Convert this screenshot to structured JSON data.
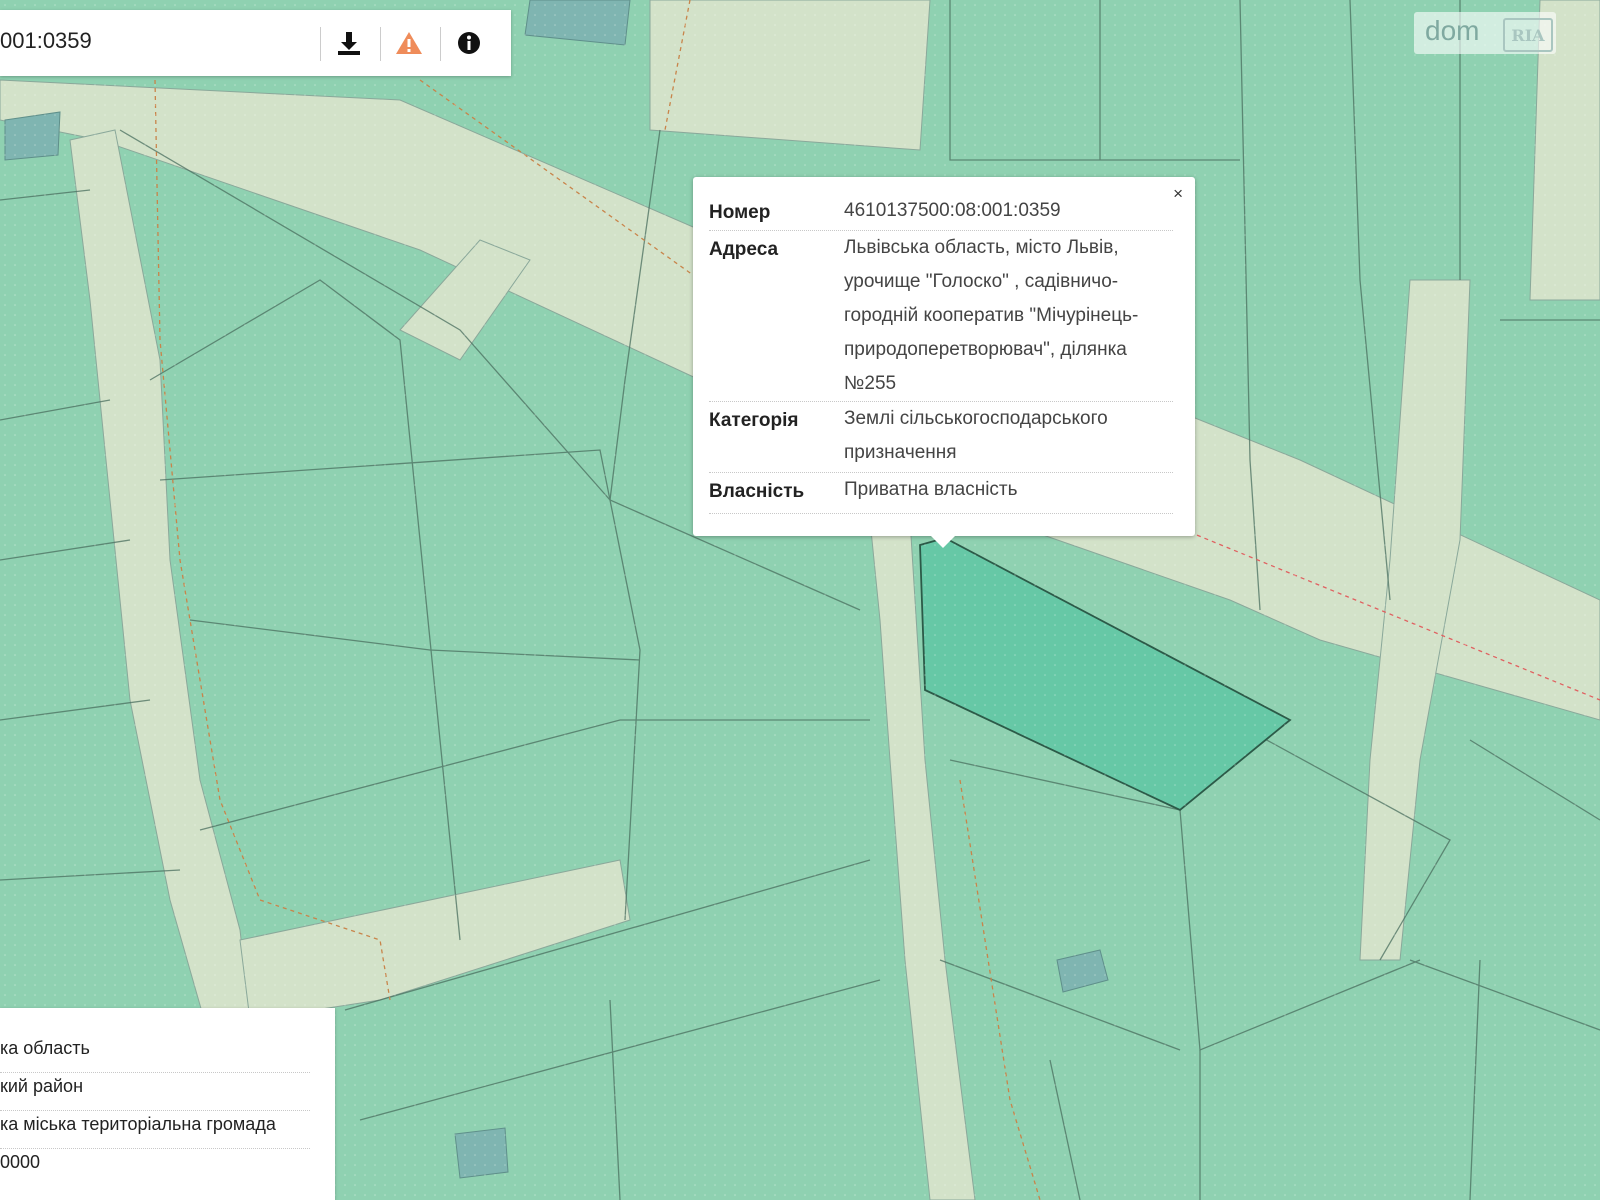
{
  "search": {
    "value": "001:0359"
  },
  "toolbar": {
    "download_icon": "download-icon",
    "warning_icon": "warning-icon",
    "info_icon": "info-icon"
  },
  "logo": {
    "dom": "dom",
    "ria": "RIA"
  },
  "popup": {
    "close": "×",
    "rows": [
      {
        "label": "Номер",
        "value": "4610137500:08:001:0359"
      },
      {
        "label": "Адреса",
        "value": "Львівська область, місто Львів, урочище \"Голоско\" , садівничо-городній кооператив \"Мічурінець-природоперетворювач\", ділянка №255"
      },
      {
        "label": "Категорія",
        "value": "Землі сільськогосподарського призначення"
      },
      {
        "label": "Власність",
        "value": "Приватна власність"
      }
    ]
  },
  "info_panel": {
    "items": [
      "ка область",
      "кий район",
      "ка міська територіальна громада",
      "0000"
    ]
  },
  "colors": {
    "parcel": "#8fd1b1",
    "road": "#d3e2c9",
    "selected": "#66c8a6",
    "building": "#7fb5b1",
    "accent_warning": "#ef8c5a"
  }
}
